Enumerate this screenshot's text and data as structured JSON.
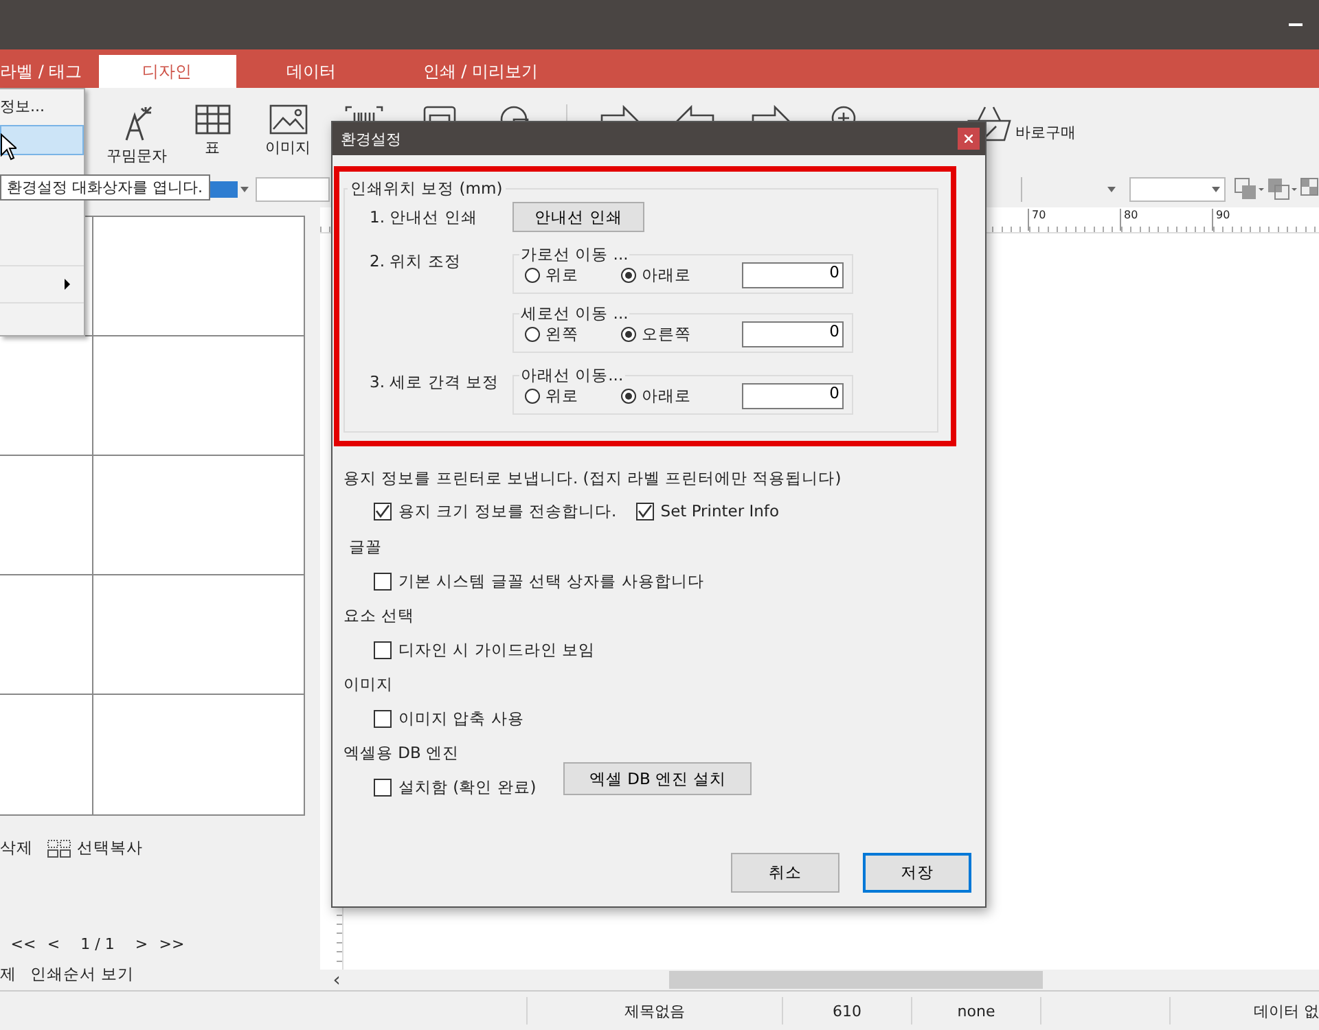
{
  "app": {
    "tabs": [
      {
        "label": "라벨 / 태그",
        "selected": false
      },
      {
        "label": "디자인",
        "selected": true
      },
      {
        "label": "데이터",
        "selected": false
      },
      {
        "label": "인쇄 / 미리보기",
        "selected": false
      }
    ]
  },
  "toolbar": {
    "tools": [
      {
        "kind": "wand",
        "label": "꾸밈문자"
      },
      {
        "kind": "table",
        "label": "표"
      },
      {
        "kind": "image",
        "label": "이미지"
      },
      {
        "kind": "barcode"
      },
      {
        "kind": "frame"
      },
      {
        "kind": "circle"
      },
      {
        "kind": "separator"
      },
      {
        "kind": "arrow-right"
      },
      {
        "kind": "arrow-left"
      },
      {
        "kind": "arrow-right"
      },
      {
        "kind": "zoom"
      },
      {
        "kind": "basket",
        "label": "바로구매"
      }
    ]
  },
  "context_menu": {
    "items": [
      {
        "label": "정보...",
        "selected": false
      },
      {
        "selected": true
      },
      {
        "selected": false,
        "submenu": true
      }
    ]
  },
  "tooltip": "환경설정 대화상자를 엽니다.",
  "ruler": {
    "labels": [
      "70",
      "80",
      "90"
    ]
  },
  "scrollbar": {
    "left_arrow": "‹"
  },
  "left_panel": {
    "actions": [
      "삭제",
      "선택복사"
    ],
    "pager": [
      "<<",
      "<",
      "1 / 1",
      ">",
      ">>"
    ],
    "bottom_links": [
      "제",
      "인쇄순서 보기"
    ]
  },
  "status_bar": {
    "cells": [
      "제목없음",
      "610",
      "none",
      "데이터 없"
    ]
  },
  "dialog": {
    "title": "환경설정",
    "position_correction": {
      "legend": "인쇄위치 보정 (mm)",
      "rows": [
        {
          "label": "1. 안내선 인쇄",
          "kind": "button",
          "button": "안내선 인쇄"
        },
        {
          "label": "2. 위치 조정",
          "kind": "groups",
          "groups": [
            {
              "legend": "가로선 이동 ...",
              "options": [
                {
                  "label": "위로",
                  "selected": false
                },
                {
                  "label": "아래로",
                  "selected": true
                }
              ],
              "value": "0"
            },
            {
              "legend": "세로선 이동 ...",
              "options": [
                {
                  "label": "왼쪽",
                  "selected": false
                },
                {
                  "label": "오른쪽",
                  "selected": true
                }
              ],
              "value": "0"
            }
          ]
        },
        {
          "label": "3. 세로 간격 보정",
          "kind": "groups",
          "groups": [
            {
              "legend": "아래선 이동...",
              "options": [
                {
                  "label": "위로",
                  "selected": false
                },
                {
                  "label": "아래로",
                  "selected": true
                }
              ],
              "value": "0"
            }
          ]
        }
      ]
    },
    "sections": [
      {
        "heading": "용지 정보를 프린터로 보냅니다. (접지 라벨 프린터에만 적용됩니다)",
        "options": [
          {
            "label": "용지 크기 정보를 전송합니다.",
            "checked": true
          },
          {
            "label": "Set Printer Info",
            "checked": true
          }
        ]
      },
      {
        "heading": "글꼴",
        "options": [
          {
            "label": "기본 시스템 글꼴 선택 상자를 사용합니다",
            "checked": false
          }
        ]
      },
      {
        "heading": "요소 선택",
        "options": [
          {
            "label": "디자인 시 가이드라인 보임",
            "checked": false
          }
        ]
      },
      {
        "heading": "이미지",
        "options": [
          {
            "label": "이미지 압축 사용",
            "checked": false
          }
        ]
      },
      {
        "heading": "엑셀용 DB 엔진",
        "options": [
          {
            "label": "설치함 (확인 완료)",
            "checked": false
          }
        ],
        "button": "엑셀 DB 엔진 설치"
      }
    ],
    "buttons": [
      {
        "label": "취소",
        "default": false
      },
      {
        "label": "저장",
        "default": true
      }
    ]
  }
}
